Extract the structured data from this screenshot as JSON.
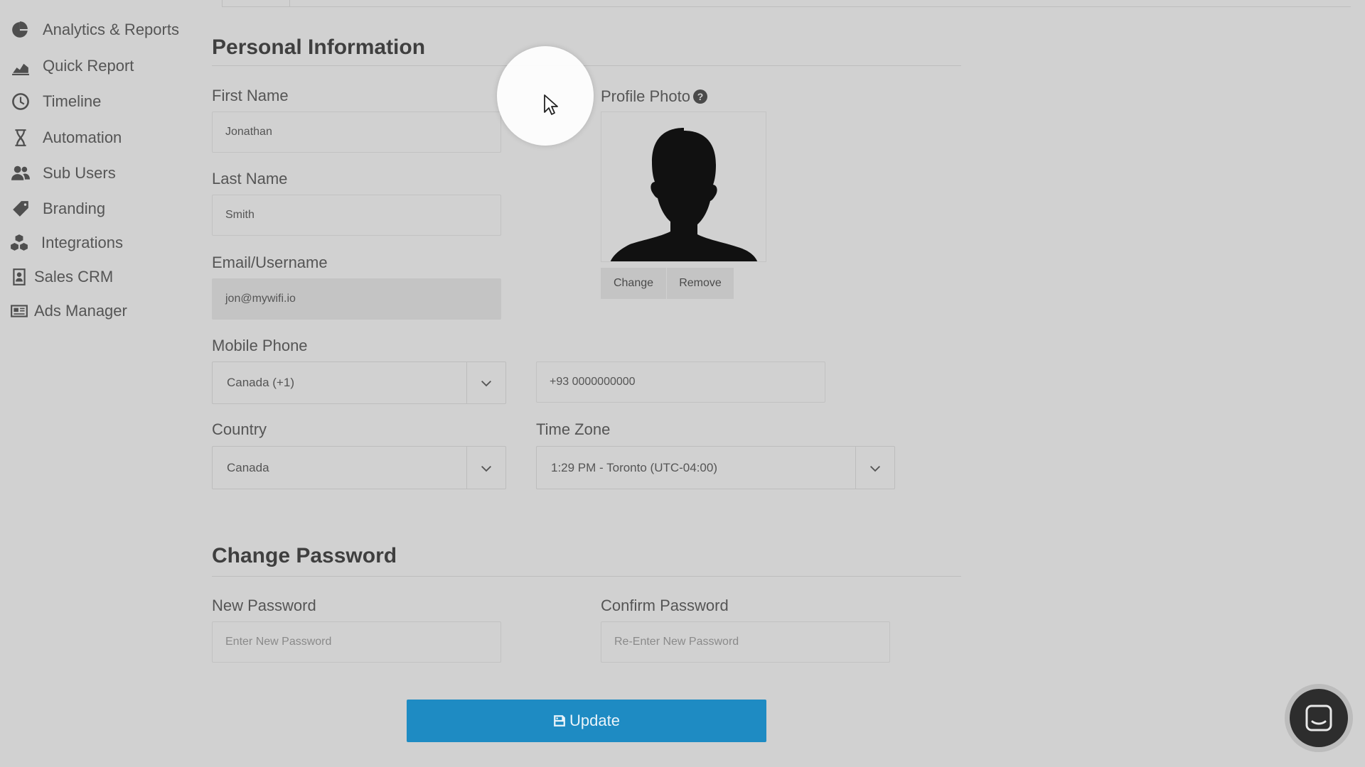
{
  "sidebar": {
    "items": [
      {
        "label": "Analytics & Reports",
        "icon": "pie-chart-icon"
      },
      {
        "label": "Quick Report",
        "icon": "area-chart-icon"
      },
      {
        "label": "Timeline",
        "icon": "clock-icon"
      },
      {
        "label": "Automation",
        "icon": "hourglass-icon"
      },
      {
        "label": "Sub Users",
        "icon": "users-icon"
      },
      {
        "label": "Branding",
        "icon": "tag-icon"
      },
      {
        "label": "Integrations",
        "icon": "cubes-icon"
      },
      {
        "label": "Sales CRM",
        "icon": "contact-card-icon"
      },
      {
        "label": "Ads Manager",
        "icon": "newspaper-icon"
      }
    ]
  },
  "personal": {
    "title": "Personal Information",
    "first_name": {
      "label": "First Name",
      "value": "Jonathan"
    },
    "last_name": {
      "label": "Last Name",
      "value": "Smith"
    },
    "email": {
      "label": "Email/Username",
      "value": "jon@mywifi.io"
    },
    "mobile": {
      "label": "Mobile Phone",
      "country_code": "Canada (+1)",
      "number": "+93 0000000000"
    },
    "country": {
      "label": "Country",
      "value": "Canada"
    },
    "timezone": {
      "label": "Time Zone",
      "value": "1:29 PM - Toronto (UTC-04:00)"
    },
    "photo": {
      "label": "Profile Photo",
      "help": "?",
      "change": "Change",
      "remove": "Remove"
    }
  },
  "password": {
    "title": "Change Password",
    "new": {
      "label": "New Password",
      "placeholder": "Enter New Password"
    },
    "confirm": {
      "label": "Confirm Password",
      "placeholder": "Re-Enter New Password"
    }
  },
  "actions": {
    "update": "Update"
  },
  "colors": {
    "accent": "#1e8bc3",
    "background": "#d1d1d1"
  }
}
